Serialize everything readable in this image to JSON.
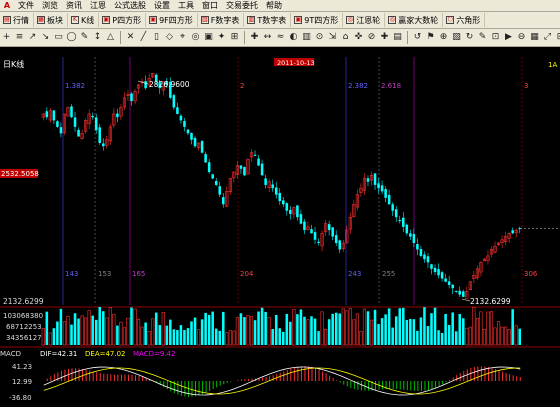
{
  "menubar": {
    "logo": "A",
    "items": [
      "文件",
      "浏览",
      "资讯",
      "江恩",
      "公式选股",
      "设置",
      "工具",
      "窗口",
      "交易委托",
      "帮助"
    ]
  },
  "toolbar1": {
    "buttons": [
      "行情",
      "板块",
      "K线",
      "P四方形",
      "9F四方形",
      "F数字表",
      "T数字表",
      "9T四方形",
      "江恩轮",
      "贏家大数轮",
      "六角形"
    ]
  },
  "toolbar2": {
    "icons": [
      "+",
      "≡",
      "↗",
      "↘",
      "▭",
      "◯",
      "✎",
      "↕",
      "△",
      "✕",
      "╱",
      "▯",
      "◇",
      "⌖",
      "◎",
      "▣",
      "✦",
      "⊞",
      "✚",
      "↔",
      "≈",
      "◐",
      "▥",
      "⊙",
      "⇲",
      "⌂",
      "✜",
      "⊘",
      "✚",
      "▤",
      "↺",
      "⚑",
      "⊕",
      "▧",
      "↻",
      "✎",
      "⊡",
      "▶",
      "⊖",
      "▦",
      "⤢",
      "⊟",
      "▩",
      "✕",
      "⊠"
    ]
  },
  "chart": {
    "title": "日K线",
    "right_tag": "1A",
    "date_label": "2011-10-13",
    "price_tag": "2532.5058",
    "high_label": "2826.9600",
    "low_label": "2132.6299",
    "low_axis_label": "2132.6299",
    "gann_top_labels": [
      "1.382",
      "2",
      "2.382",
      "2.618",
      "3"
    ],
    "gann_bottom_labels": [
      "143",
      "153",
      "165",
      "204",
      "243",
      "255",
      "306"
    ],
    "volume_labels": [
      "103068380",
      "68712253",
      "34356127"
    ],
    "macd_title": "MACD",
    "dif": "DIF=42.31",
    "dea": "DEA=47.02",
    "macd": "MACD=9.42",
    "macd_axis_labels": [
      "41.23",
      "12.99",
      "-36.80"
    ],
    "colors": {
      "up": "#ff3030",
      "down": "#00ffff",
      "dif_line": "#ffffff",
      "dea_line": "#ffff00"
    }
  },
  "chart_data": {
    "type": "candlestick",
    "interval": "daily",
    "high": 2826.96,
    "low": 2132.6299,
    "closes": [
      2700,
      2690,
      2710,
      2680,
      2660,
      2640,
      2700,
      2720,
      2690,
      2660,
      2630,
      2640,
      2680,
      2700,
      2690,
      2650,
      2610,
      2600,
      2620,
      2660,
      2700,
      2690,
      2720,
      2750,
      2760,
      2740,
      2770,
      2790,
      2800,
      2780,
      2810,
      2826,
      2800,
      2780,
      2800,
      2790,
      2750,
      2720,
      2700,
      2680,
      2660,
      2640,
      2620,
      2600,
      2610,
      2580,
      2550,
      2520,
      2500,
      2480,
      2450,
      2420,
      2460,
      2500,
      2520,
      2540,
      2530,
      2510,
      2560,
      2580,
      2570,
      2540,
      2510,
      2480,
      2490,
      2470,
      2450,
      2430,
      2420,
      2400,
      2390,
      2410,
      2380,
      2360,
      2340,
      2350,
      2330,
      2310,
      2300,
      2330,
      2360,
      2340,
      2320,
      2300,
      2280,
      2300,
      2340,
      2380,
      2420,
      2450,
      2470,
      2500,
      2490,
      2510,
      2480,
      2470,
      2460,
      2440,
      2420,
      2400,
      2380,
      2370,
      2350,
      2330,
      2320,
      2300,
      2280,
      2260,
      2250,
      2240,
      2220,
      2210,
      2200,
      2190,
      2180,
      2170,
      2160,
      2150,
      2140,
      2133,
      2150,
      2180,
      2200,
      2220,
      2240,
      2250,
      2260,
      2280,
      2290,
      2300,
      2310,
      2320,
      2330,
      2330,
      2340,
      2345
    ]
  }
}
